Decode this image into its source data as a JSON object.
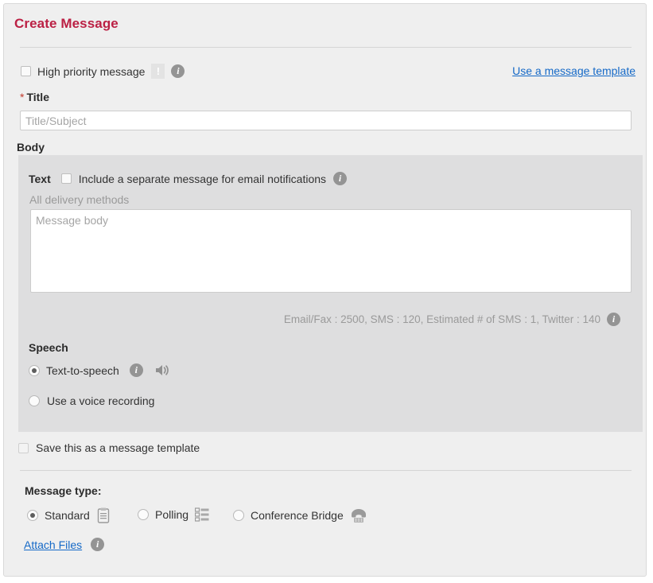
{
  "page": {
    "title": "Create Message"
  },
  "priority": {
    "checkbox_label": "High priority message",
    "checked": false,
    "bang_icon_glyph": "!",
    "info_icon_glyph": "i"
  },
  "template_link": {
    "label": "Use a message template"
  },
  "title_field": {
    "required_marker": "*",
    "label": "Title",
    "value": "",
    "placeholder": "Title/Subject"
  },
  "body": {
    "section_label": "Body",
    "text_label": "Text",
    "email_checkbox_label": "Include a separate message for email notifications",
    "email_checkbox_checked": false,
    "info_icon_glyph": "i",
    "delivery_note": "All delivery methods",
    "message_value": "",
    "message_placeholder": "Message body",
    "counter_text": "Email/Fax : 2500, SMS : 120, Estimated # of SMS : 1, Twitter : 140",
    "counter_info_icon_glyph": "i"
  },
  "speech": {
    "section_label": "Speech",
    "options": [
      {
        "label": "Text-to-speech",
        "checked": true
      },
      {
        "label": "Use a voice recording",
        "checked": false
      }
    ],
    "info_icon_glyph": "i"
  },
  "save_template": {
    "label": "Save this as a message template",
    "checked": false
  },
  "message_type": {
    "section_label": "Message type:",
    "options": [
      {
        "label": "Standard",
        "checked": true,
        "icon": "clipboard-icon"
      },
      {
        "label": "Polling",
        "checked": false,
        "icon": "list-icon"
      },
      {
        "label": "Conference Bridge",
        "checked": false,
        "icon": "telephone-icon"
      }
    ]
  },
  "attach": {
    "link_label": "Attach Files",
    "info_icon_glyph": "i"
  },
  "colors": {
    "title_red": "#bb2044",
    "link_blue": "#1569c7",
    "panel_gray": "#dededf",
    "page_gray": "#efefef",
    "icon_gray": "#949494"
  }
}
